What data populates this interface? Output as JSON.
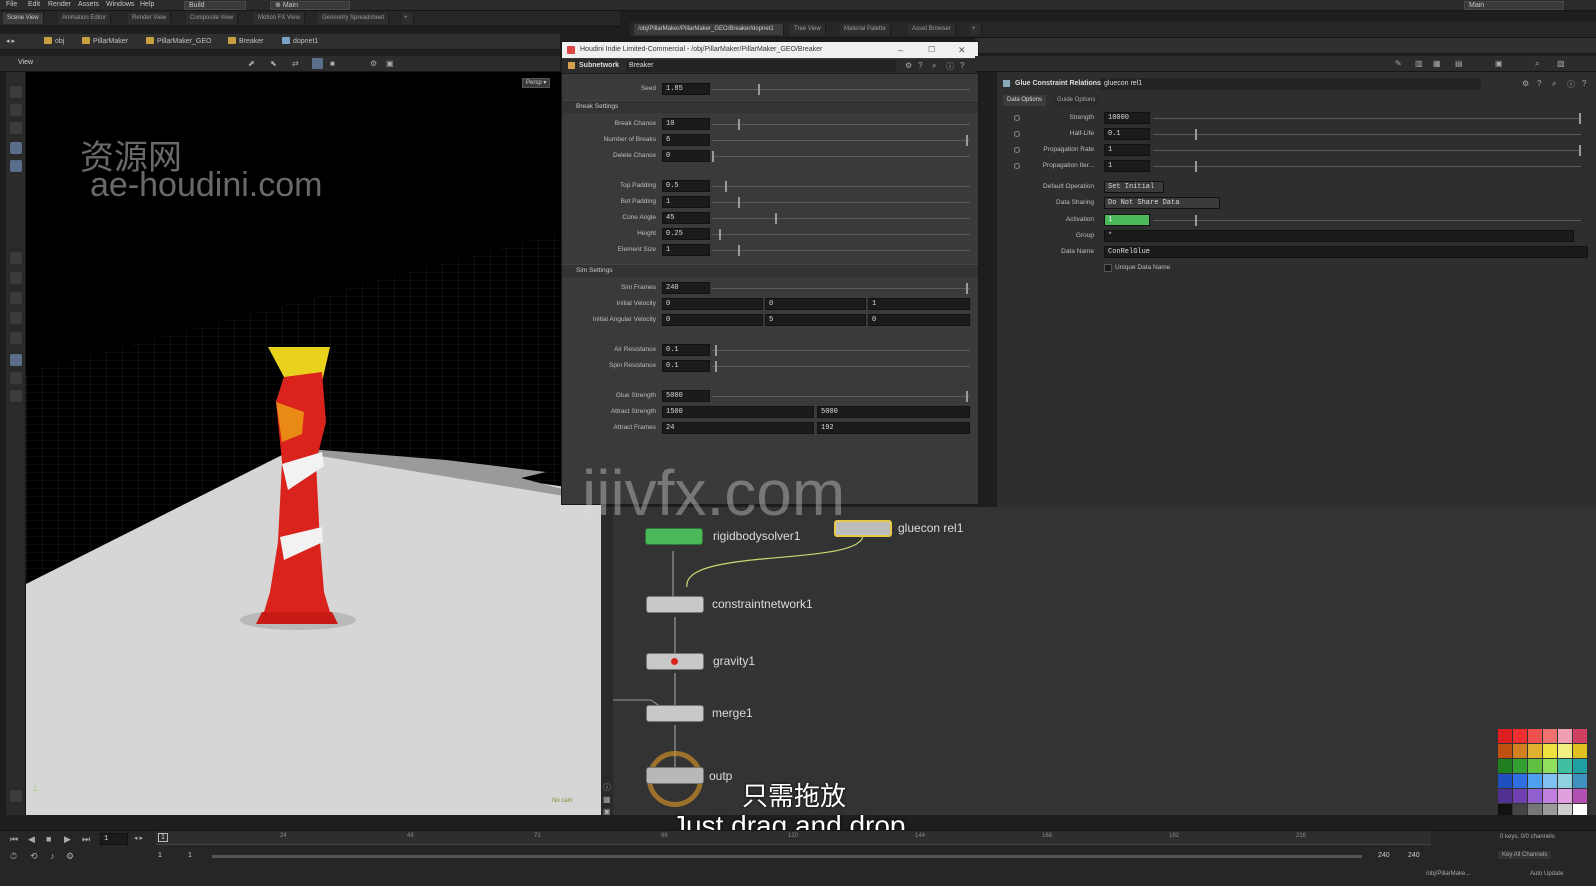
{
  "menubar": {
    "items": [
      "File",
      "Edit",
      "Render",
      "Assets",
      "Windows",
      "Help"
    ],
    "desktop": "Build",
    "workspace": "Main",
    "right_desktop": "Main"
  },
  "left_tabs": [
    "Scene View",
    "Animation Editor",
    "Render View",
    "Composite View",
    "Motion FX View",
    "Geometry Spreadsheet"
  ],
  "right_tabs": [
    "/obj/PillarMaker/PillarMaker_GEO/Breaker/dopnet1",
    "Tree View",
    "Material Palette",
    "Asset Browser"
  ],
  "path": [
    "obj",
    "PillarMaker",
    "PillarMaker_GEO",
    "Breaker",
    "dopnet1"
  ],
  "viewport": {
    "menu_label": "View",
    "persp": "Persp",
    "cam": "No cam",
    "status": "Auto Update"
  },
  "watermarks": {
    "cn": "资源网",
    "site1": "ae-houdini.com",
    "site2": "iiivfx.com"
  },
  "param_window": {
    "title": "Houdini Indie Limited-Commercial - /obj/PillarMaker/PillarMaker_GEO/Breaker",
    "node_type": "Subnetwork",
    "node_name": "Breaker",
    "seed_label": "Seed",
    "seed": "1.85",
    "break_section": "Break Settings",
    "break_rows": [
      {
        "label": "Break Chance",
        "value": "10"
      },
      {
        "label": "Number of Breaks",
        "value": "6"
      },
      {
        "label": "Delete Chance",
        "value": "0"
      }
    ],
    "pad_rows": [
      {
        "label": "Top Padding",
        "value": "0.5"
      },
      {
        "label": "Bot Padding",
        "value": "1"
      },
      {
        "label": "Cone Angle",
        "value": "45"
      },
      {
        "label": "Height",
        "value": "0.25"
      },
      {
        "label": "Element Size",
        "value": "1"
      }
    ],
    "sim_section": "Sim Settings",
    "sim_frames_label": "Sim Frames",
    "sim_frames": "240",
    "init_vel_label": "Initial Velocity",
    "init_vel": [
      "0",
      "0",
      "1"
    ],
    "init_ang_label": "Initial Angular Velocity",
    "init_ang": [
      "0",
      "5",
      "0"
    ],
    "resist_rows": [
      {
        "label": "Air Resistance",
        "value": "0.1"
      },
      {
        "label": "Spin Resistance",
        "value": "0.1"
      }
    ],
    "glue_label": "Glue Strength",
    "glue": "5000",
    "attract_label": "Attract Strength",
    "attract": [
      "1500",
      "5000"
    ],
    "attract_frames_label": "Attract Frames",
    "attract_frames": [
      "24",
      "192"
    ]
  },
  "right_param": {
    "node_type": "Glue Constraint Relationship",
    "node_name": "gluecon rel1",
    "tabs": [
      "Data Options",
      "Guide Options"
    ],
    "rows": [
      {
        "label": "Strength",
        "value": "10000"
      },
      {
        "label": "Half-Life",
        "value": "0.1"
      },
      {
        "label": "Propagation Rate",
        "value": "1"
      },
      {
        "label": "Propagation Iter...",
        "value": "1"
      }
    ],
    "default_op_label": "Default Operation",
    "default_op": "Set Initial",
    "data_sharing_label": "Data Sharing",
    "data_sharing": "Do Not Share Data",
    "activation_label": "Activation",
    "activation": "1",
    "group_label": "Group",
    "group": "*",
    "data_name_label": "Data Name",
    "data_name": "ConRelGlue",
    "unique_label": "Unique Data Name"
  },
  "network": {
    "nodes": [
      {
        "name": "rigidbodysolver1"
      },
      {
        "name": "gluecon rel1"
      },
      {
        "name": "constraintnetwork1"
      },
      {
        "name": "gravity1"
      },
      {
        "name": "merge1"
      },
      {
        "name": "outp"
      }
    ]
  },
  "subtitles": {
    "cn": "只需拖放",
    "en": "Just drag and drop"
  },
  "timeline": {
    "frame": "1",
    "start": "1",
    "start2": "1",
    "end": "240",
    "end2": "240",
    "ticks": [
      "24",
      "48",
      "72",
      "96",
      "120",
      "144",
      "168",
      "192",
      "216"
    ],
    "keys_label": "0 keys, 0/0 channels",
    "key_all": "Key All Channels",
    "auto_update": "Auto Update",
    "path_status": "/obj/PillarMake..."
  },
  "colors": {
    "solver_green": "#4bb85a",
    "select_yellow": "#e6c94a",
    "pillar_red": "#d9231c",
    "pillar_yellow": "#e9d21e",
    "ground": "#d9d9d9"
  }
}
